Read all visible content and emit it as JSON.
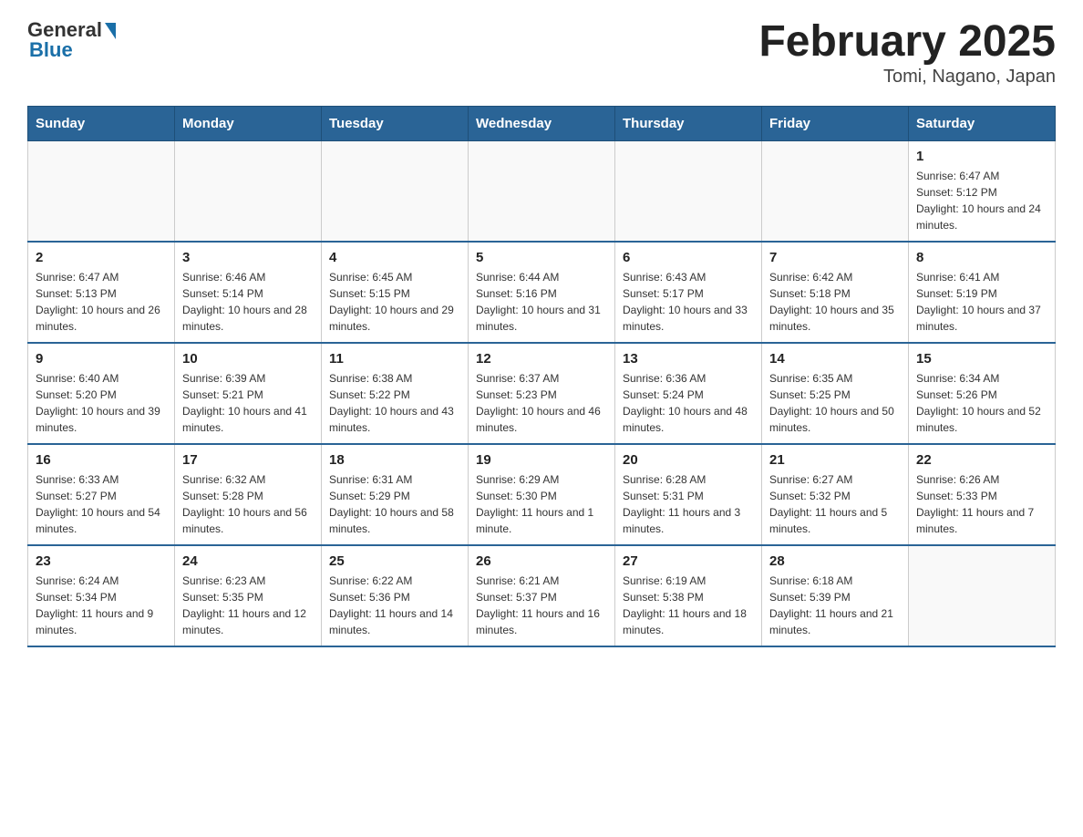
{
  "header": {
    "logo_general": "General",
    "logo_blue": "Blue",
    "title": "February 2025",
    "subtitle": "Tomi, Nagano, Japan"
  },
  "days_of_week": [
    "Sunday",
    "Monday",
    "Tuesday",
    "Wednesday",
    "Thursday",
    "Friday",
    "Saturday"
  ],
  "weeks": [
    [
      {
        "day": "",
        "info": ""
      },
      {
        "day": "",
        "info": ""
      },
      {
        "day": "",
        "info": ""
      },
      {
        "day": "",
        "info": ""
      },
      {
        "day": "",
        "info": ""
      },
      {
        "day": "",
        "info": ""
      },
      {
        "day": "1",
        "info": "Sunrise: 6:47 AM\nSunset: 5:12 PM\nDaylight: 10 hours and 24 minutes."
      }
    ],
    [
      {
        "day": "2",
        "info": "Sunrise: 6:47 AM\nSunset: 5:13 PM\nDaylight: 10 hours and 26 minutes."
      },
      {
        "day": "3",
        "info": "Sunrise: 6:46 AM\nSunset: 5:14 PM\nDaylight: 10 hours and 28 minutes."
      },
      {
        "day": "4",
        "info": "Sunrise: 6:45 AM\nSunset: 5:15 PM\nDaylight: 10 hours and 29 minutes."
      },
      {
        "day": "5",
        "info": "Sunrise: 6:44 AM\nSunset: 5:16 PM\nDaylight: 10 hours and 31 minutes."
      },
      {
        "day": "6",
        "info": "Sunrise: 6:43 AM\nSunset: 5:17 PM\nDaylight: 10 hours and 33 minutes."
      },
      {
        "day": "7",
        "info": "Sunrise: 6:42 AM\nSunset: 5:18 PM\nDaylight: 10 hours and 35 minutes."
      },
      {
        "day": "8",
        "info": "Sunrise: 6:41 AM\nSunset: 5:19 PM\nDaylight: 10 hours and 37 minutes."
      }
    ],
    [
      {
        "day": "9",
        "info": "Sunrise: 6:40 AM\nSunset: 5:20 PM\nDaylight: 10 hours and 39 minutes."
      },
      {
        "day": "10",
        "info": "Sunrise: 6:39 AM\nSunset: 5:21 PM\nDaylight: 10 hours and 41 minutes."
      },
      {
        "day": "11",
        "info": "Sunrise: 6:38 AM\nSunset: 5:22 PM\nDaylight: 10 hours and 43 minutes."
      },
      {
        "day": "12",
        "info": "Sunrise: 6:37 AM\nSunset: 5:23 PM\nDaylight: 10 hours and 46 minutes."
      },
      {
        "day": "13",
        "info": "Sunrise: 6:36 AM\nSunset: 5:24 PM\nDaylight: 10 hours and 48 minutes."
      },
      {
        "day": "14",
        "info": "Sunrise: 6:35 AM\nSunset: 5:25 PM\nDaylight: 10 hours and 50 minutes."
      },
      {
        "day": "15",
        "info": "Sunrise: 6:34 AM\nSunset: 5:26 PM\nDaylight: 10 hours and 52 minutes."
      }
    ],
    [
      {
        "day": "16",
        "info": "Sunrise: 6:33 AM\nSunset: 5:27 PM\nDaylight: 10 hours and 54 minutes."
      },
      {
        "day": "17",
        "info": "Sunrise: 6:32 AM\nSunset: 5:28 PM\nDaylight: 10 hours and 56 minutes."
      },
      {
        "day": "18",
        "info": "Sunrise: 6:31 AM\nSunset: 5:29 PM\nDaylight: 10 hours and 58 minutes."
      },
      {
        "day": "19",
        "info": "Sunrise: 6:29 AM\nSunset: 5:30 PM\nDaylight: 11 hours and 1 minute."
      },
      {
        "day": "20",
        "info": "Sunrise: 6:28 AM\nSunset: 5:31 PM\nDaylight: 11 hours and 3 minutes."
      },
      {
        "day": "21",
        "info": "Sunrise: 6:27 AM\nSunset: 5:32 PM\nDaylight: 11 hours and 5 minutes."
      },
      {
        "day": "22",
        "info": "Sunrise: 6:26 AM\nSunset: 5:33 PM\nDaylight: 11 hours and 7 minutes."
      }
    ],
    [
      {
        "day": "23",
        "info": "Sunrise: 6:24 AM\nSunset: 5:34 PM\nDaylight: 11 hours and 9 minutes."
      },
      {
        "day": "24",
        "info": "Sunrise: 6:23 AM\nSunset: 5:35 PM\nDaylight: 11 hours and 12 minutes."
      },
      {
        "day": "25",
        "info": "Sunrise: 6:22 AM\nSunset: 5:36 PM\nDaylight: 11 hours and 14 minutes."
      },
      {
        "day": "26",
        "info": "Sunrise: 6:21 AM\nSunset: 5:37 PM\nDaylight: 11 hours and 16 minutes."
      },
      {
        "day": "27",
        "info": "Sunrise: 6:19 AM\nSunset: 5:38 PM\nDaylight: 11 hours and 18 minutes."
      },
      {
        "day": "28",
        "info": "Sunrise: 6:18 AM\nSunset: 5:39 PM\nDaylight: 11 hours and 21 minutes."
      },
      {
        "day": "",
        "info": ""
      }
    ]
  ]
}
